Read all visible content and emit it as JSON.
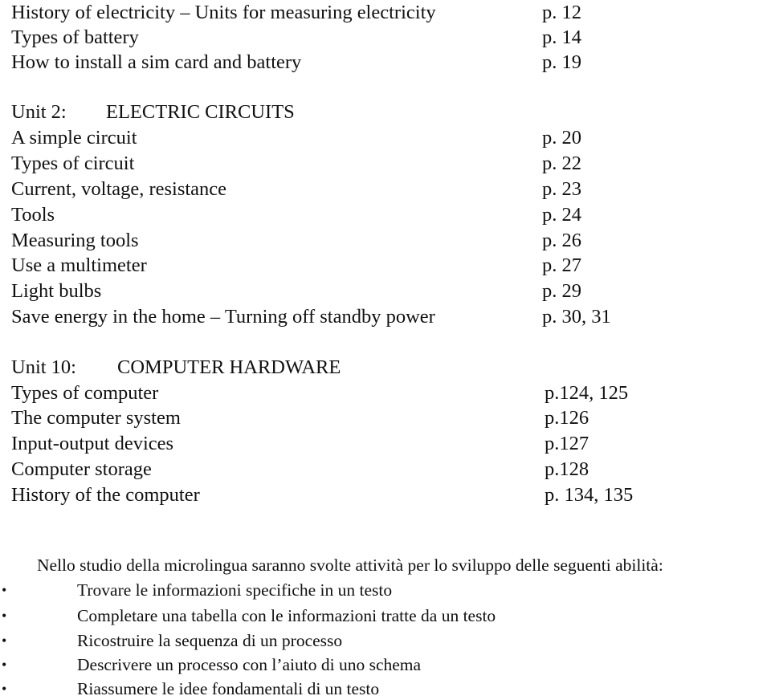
{
  "sections": [
    {
      "unit_label": "",
      "unit_title": "",
      "entries": [
        {
          "topic": "History of electricity – Units for measuring electricity",
          "page": "p. 12"
        },
        {
          "topic": "Types of battery",
          "page": "p. 14"
        },
        {
          "topic": "How to install a sim card and battery",
          "page": "p. 19"
        }
      ]
    },
    {
      "unit_label": "Unit 2:",
      "unit_title": "ELECTRIC CIRCUITS",
      "entries": [
        {
          "topic": "A simple circuit",
          "page": "p. 20"
        },
        {
          "topic": "Types of circuit",
          "page": "p. 22"
        },
        {
          "topic": "Current, voltage, resistance",
          "page": "p. 23"
        },
        {
          "topic": "Tools",
          "page": "p. 24"
        },
        {
          "topic": "Measuring tools",
          "page": "p. 26"
        },
        {
          "topic": "Use a multimeter",
          "page": "p. 27"
        },
        {
          "topic": "Light bulbs",
          "page": "p. 29"
        },
        {
          "topic": "Save energy in the home – Turning off standby power",
          "page": "p. 30, 31"
        }
      ]
    },
    {
      "unit_label": "Unit 10:",
      "unit_title": "COMPUTER HARDWARE",
      "entries": [
        {
          "topic": "Types of computer",
          "page": "p.124, 125"
        },
        {
          "topic": "The computer system",
          "page": "p.126"
        },
        {
          "topic": "Input-output devices",
          "page": "p.127"
        },
        {
          "topic": "Computer storage",
          "page": "p.128"
        },
        {
          "topic": "History of the computer",
          "page": "p. 134, 135"
        }
      ]
    }
  ],
  "skills": {
    "intro": "Nello studio della microlingua saranno svolte attività per lo sviluppo delle seguenti abilità:",
    "bullet_symbol": "•",
    "items": [
      "Trovare le informazioni specifiche in un testo",
      "Completare una tabella con le informazioni tratte da un testo",
      "Ricostruire la sequenza di un processo",
      "Descrivere un processo con l’aiuto di uno schema",
      "Riassumere le idee fondamentali di un testo"
    ]
  }
}
